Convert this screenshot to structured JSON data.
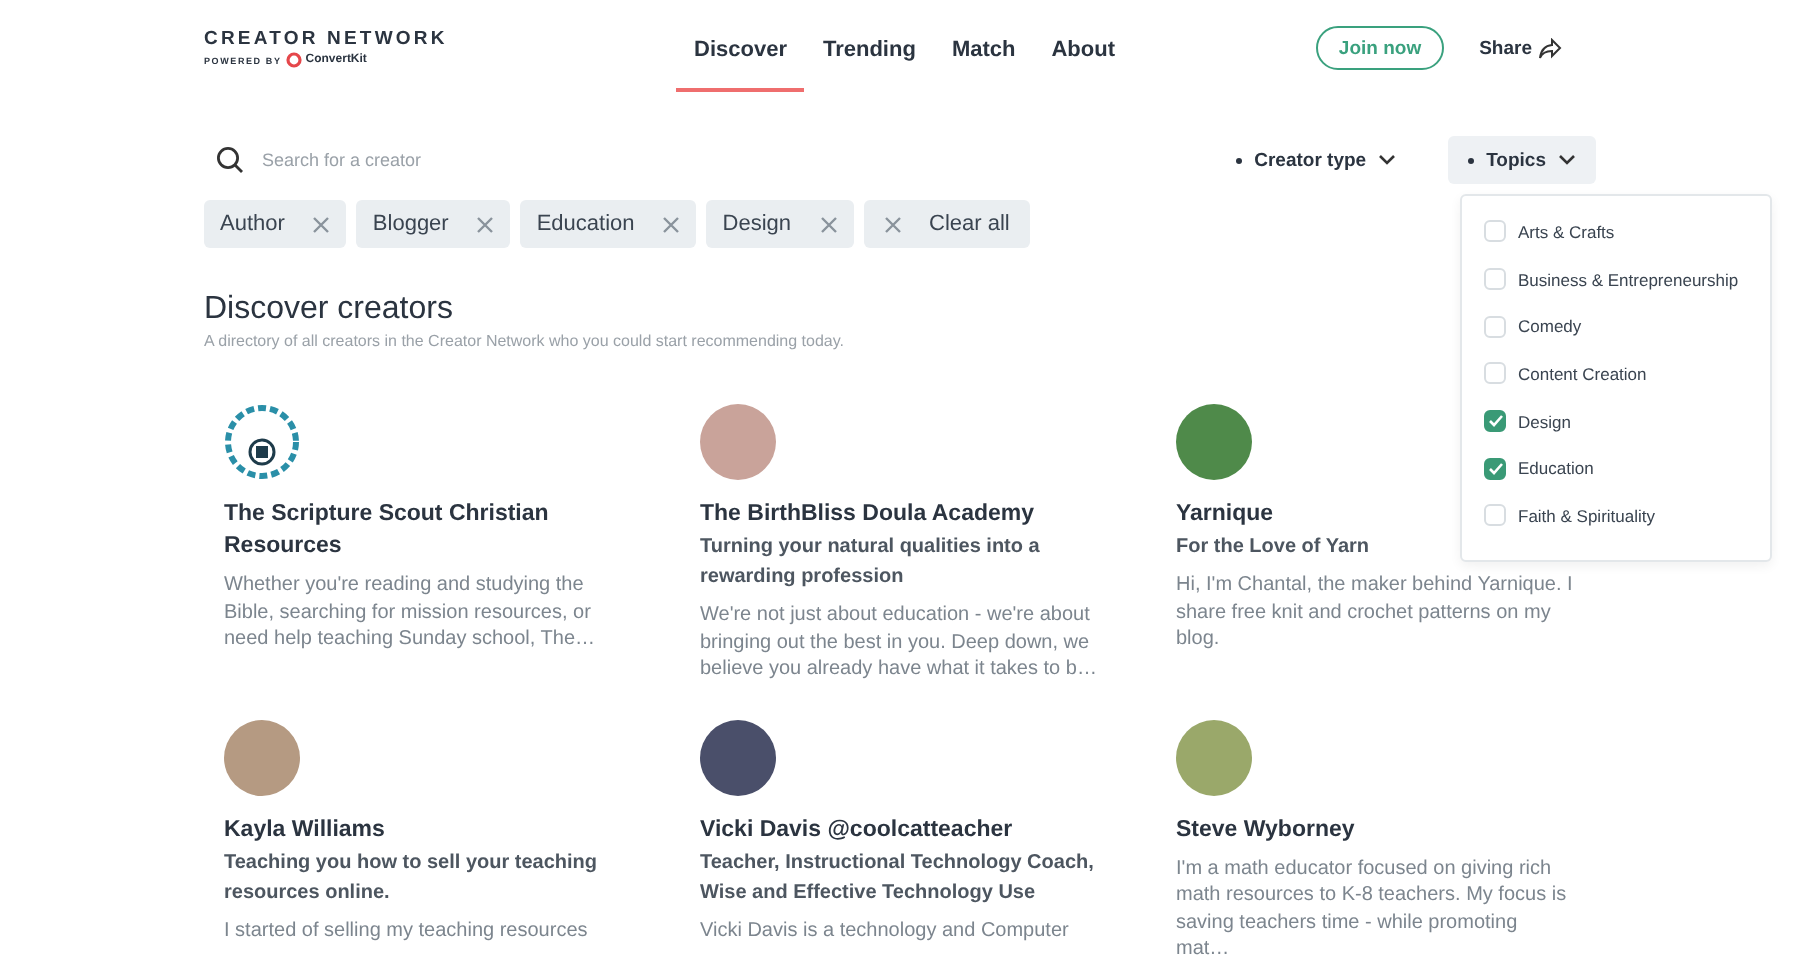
{
  "logo": {
    "title": "CREATOR NETWORK",
    "powered_by": "POWERED BY",
    "brand": "ConvertKit"
  },
  "nav": [
    {
      "label": "Discover",
      "selected": true
    },
    {
      "label": "Trending",
      "selected": false
    },
    {
      "label": "Match",
      "selected": false
    },
    {
      "label": "About",
      "selected": false
    }
  ],
  "join_button": "Join now",
  "share_button": "Share",
  "search": {
    "placeholder": "Search for a creator"
  },
  "filters": [
    {
      "label": "Creator type",
      "expanded": false
    },
    {
      "label": "Topics",
      "expanded": true
    }
  ],
  "chips": [
    "Author",
    "Blogger",
    "Education",
    "Design"
  ],
  "clear_all": "Clear all",
  "heading": "Discover creators",
  "subheading": "A directory of all creators in the Creator Network who you could start recommending today.",
  "topics": [
    {
      "label": "Arts & Crafts",
      "checked": false
    },
    {
      "label": "Business & Entrepreneurship",
      "checked": false
    },
    {
      "label": "Comedy",
      "checked": false
    },
    {
      "label": "Content Creation",
      "checked": false
    },
    {
      "label": "Design",
      "checked": true
    },
    {
      "label": "Education",
      "checked": true
    },
    {
      "label": "Faith & Spirituality",
      "checked": false
    }
  ],
  "creators": [
    {
      "name": "The Scripture Scout Christian Resources",
      "description": "Whether you're reading and studying the Bible, searching for mission resources, or need help teaching Sunday school, The…",
      "kind": "logo"
    },
    {
      "name": "The BirthBliss Doula Academy",
      "tagline": "Turning your natural qualities into a rewarding profession",
      "description": "We're not just about education - we're about bringing out the best in you. Deep down, we believe you already have what it takes to b…",
      "kind": "photo"
    },
    {
      "name": "Yarnique",
      "tagline": "For the Love of Yarn",
      "description": "Hi, I'm Chantal, the maker behind Yarnique. I share free knit and crochet patterns on my blog.",
      "kind": "photo"
    },
    {
      "name": "Kayla Williams",
      "tagline": "Teaching you how to sell your teaching resources online.",
      "description": "I started of selling my teaching resources",
      "kind": "photo"
    },
    {
      "name": "Vicki Davis @coolcatteacher",
      "tagline": "Teacher, Instructional Technology Coach, Wise and Effective Technology Use",
      "description": "Vicki Davis is a technology and Computer",
      "kind": "photo"
    },
    {
      "name": "Steve Wyborney",
      "description": "I'm a math educator focused on giving rich math resources to K-8 teachers. My focus is saving teachers time - while promoting mat…",
      "kind": "photo"
    }
  ]
}
